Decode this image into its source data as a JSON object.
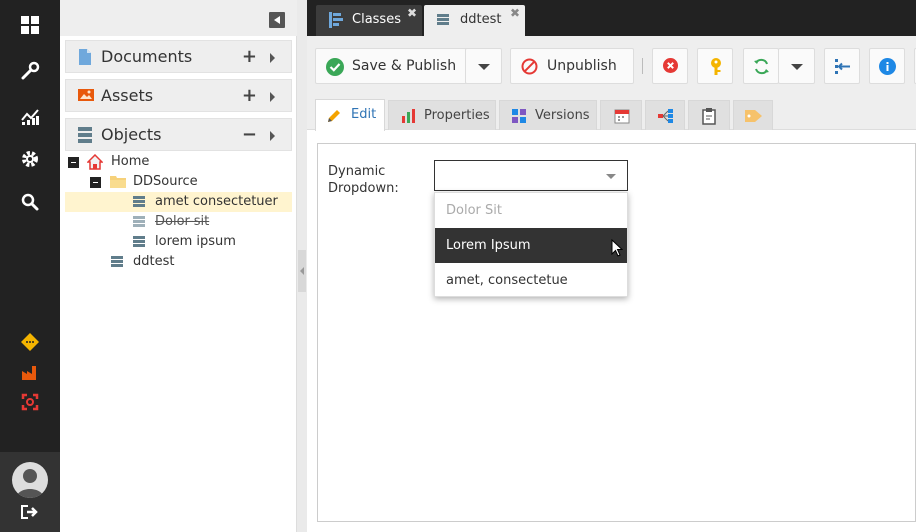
{
  "rail": {
    "icons": [
      "dashboard-icon",
      "wrench-icon",
      "chart-icon",
      "gear-icon",
      "search-icon",
      "notification-icon",
      "factory-icon",
      "target-icon",
      "user-avatar",
      "logout-icon"
    ]
  },
  "tree": {
    "sections": [
      {
        "label": "Documents",
        "action": "+",
        "icon": "document-icon"
      },
      {
        "label": "Assets",
        "action": "+",
        "icon": "image-icon"
      },
      {
        "label": "Objects",
        "action": "−",
        "icon": "objects-icon"
      }
    ],
    "nodes": [
      {
        "label": "Home"
      },
      {
        "label": "DDSource"
      },
      {
        "label": "amet consectetuer",
        "selected": true
      },
      {
        "label": "Dolor-sit",
        "unpublished": true
      },
      {
        "label": "lorem ipsum"
      },
      {
        "label": "ddtest"
      }
    ]
  },
  "tabs": [
    {
      "label": "Classes",
      "close": "✖"
    },
    {
      "label": "ddtest",
      "close": "✖",
      "active": true
    }
  ],
  "toolbar": {
    "save_publish": "Save & Publish",
    "unpublish": "Unpublish"
  },
  "subtabs": {
    "edit": "Edit",
    "properties": "Properties",
    "versions": "Versions"
  },
  "form": {
    "field_label": "Dynamic Dropdown:",
    "selected_value": "",
    "options": [
      {
        "label": "Dolor Sit",
        "disabled": true
      },
      {
        "label": "Lorem Ipsum",
        "hovered": true
      },
      {
        "label": "amet, consectetue"
      }
    ]
  },
  "colors": {
    "rail_bg": "#222222",
    "accent_blue": "#2f74b5",
    "selected_row": "#fff4cf",
    "hover_option": "#333333",
    "publish_green": "#3aa757",
    "danger_red": "#e53935"
  }
}
